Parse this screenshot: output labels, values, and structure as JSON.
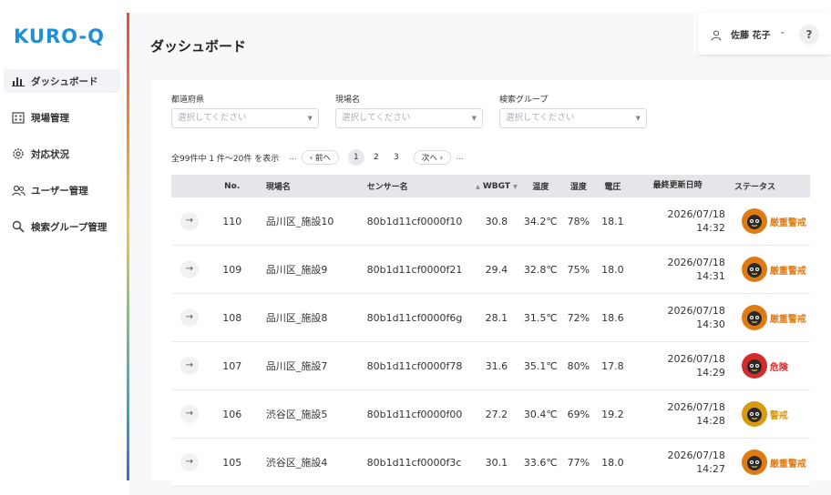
{
  "app": {
    "logo": "KURO-Q"
  },
  "sidebar": {
    "items": [
      {
        "label": "ダッシュボード",
        "icon": "bar-chart-icon",
        "active": true
      },
      {
        "label": "現場管理",
        "icon": "building-icon",
        "active": false
      },
      {
        "label": "対応状況",
        "icon": "gear-icon",
        "active": false
      },
      {
        "label": "ユーザー管理",
        "icon": "users-icon",
        "active": false
      },
      {
        "label": "検索グループ管理",
        "icon": "search-icon",
        "active": false
      }
    ]
  },
  "header": {
    "title": "ダッシュボード",
    "user_name": "佐藤 花子",
    "help_label": "?"
  },
  "filters": [
    {
      "label": "都道府県",
      "placeholder": "選択してください"
    },
    {
      "label": "現場名",
      "placeholder": "選択してください"
    },
    {
      "label": "検索グループ",
      "placeholder": "選択してください"
    }
  ],
  "pagination": {
    "summary": "全99件中 1 件〜20件 を表示",
    "prev_label": "‹ 前へ",
    "next_label": "次へ ›",
    "pages": [
      "1",
      "2",
      "3"
    ],
    "current_page": "1",
    "ellipsis": "..."
  },
  "table": {
    "headers": {
      "no": "No.",
      "site": "現場名",
      "sensor": "センサー名",
      "wbgt": "WBGT",
      "temperature": "温度",
      "humidity": "湿度",
      "voltage": "電圧",
      "updated": "最終更新日時",
      "status": "ステータス"
    },
    "rows": [
      {
        "no": "110",
        "site": "品川区_施設10",
        "sensor": "80b1d11cf0000f10",
        "wbgt": "30.8",
        "temperature": "34.2℃",
        "humidity": "78%",
        "voltage": "18.1",
        "date": "2026/07/18",
        "time": "14:32",
        "status": "厳重警戒",
        "status_level": "severe"
      },
      {
        "no": "109",
        "site": "品川区_施設9",
        "sensor": "80b1d11cf0000f21",
        "wbgt": "29.4",
        "temperature": "32.8℃",
        "humidity": "75%",
        "voltage": "18.0",
        "date": "2026/07/18",
        "time": "14:31",
        "status": "厳重警戒",
        "status_level": "severe"
      },
      {
        "no": "108",
        "site": "品川区_施設8",
        "sensor": "80b1d11cf0000f6g",
        "wbgt": "28.1",
        "temperature": "31.5℃",
        "humidity": "72%",
        "voltage": "18.6",
        "date": "2026/07/18",
        "time": "14:30",
        "status": "厳重警戒",
        "status_level": "severe"
      },
      {
        "no": "107",
        "site": "品川区_施設7",
        "sensor": "80b1d11cf0000f78",
        "wbgt": "31.6",
        "temperature": "35.1℃",
        "humidity": "80%",
        "voltage": "17.8",
        "date": "2026/07/18",
        "time": "14:29",
        "status": "危険",
        "status_level": "danger"
      },
      {
        "no": "106",
        "site": "渋谷区_施設5",
        "sensor": "80b1d11cf0000f00",
        "wbgt": "27.2",
        "temperature": "30.4℃",
        "humidity": "69%",
        "voltage": "19.2",
        "date": "2026/07/18",
        "time": "14:28",
        "status": "警戒",
        "status_level": "warning"
      },
      {
        "no": "105",
        "site": "渋谷区_施設4",
        "sensor": "80b1d11cf0000f3c",
        "wbgt": "30.1",
        "temperature": "33.6℃",
        "humidity": "77%",
        "voltage": "18.0",
        "date": "2026/07/18",
        "time": "14:27",
        "status": "厳重警戒",
        "status_level": "severe"
      }
    ]
  },
  "colors": {
    "logo": "#1f8fd6",
    "severe": "#e07b14",
    "danger": "#d42b2b",
    "warning": "#d99a12"
  }
}
